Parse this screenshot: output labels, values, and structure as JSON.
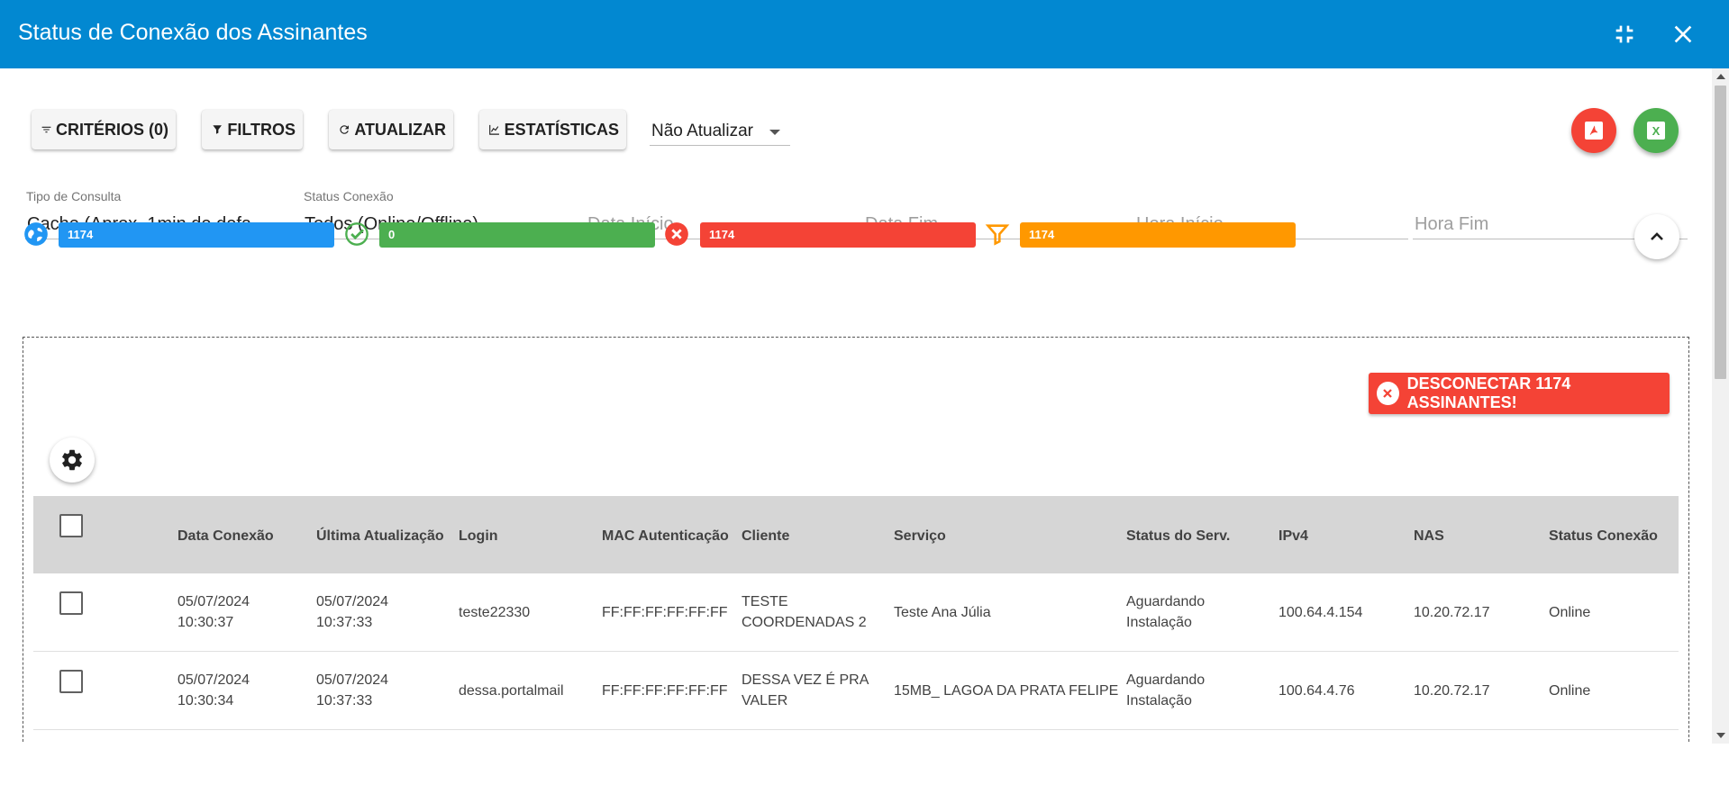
{
  "window": {
    "title": "Status de Conexão dos Assinantes",
    "icons": {
      "minimize": "fullscreen-exit-icon",
      "close": "close-icon"
    }
  },
  "toolbar": {
    "criterios_label": "CRITÉRIOS (0)",
    "filtros_label": "FILTROS",
    "atualizar_label": "ATUALIZAR",
    "estatisticas_label": "ESTATÍSTICAS",
    "refresh_select_value": "Não Atualizar",
    "pdf_label": "PDF",
    "excel_label": "X"
  },
  "filters": {
    "tipo_consulta": {
      "label": "Tipo de Consulta",
      "value": "Cache (Aprox. 1min de defa..."
    },
    "status_conexao": {
      "label": "Status Conexão",
      "value": "Todos (Online/Offline)"
    },
    "data_inicio": {
      "placeholder": "Data Início"
    },
    "data_fim": {
      "placeholder": "Data Fim"
    },
    "hora_inicio": {
      "placeholder": "Hora Início"
    },
    "hora_fim": {
      "placeholder": "Hora Fim"
    }
  },
  "stats": {
    "total": "1174",
    "online": "0",
    "offline": "1174",
    "filtered": "1174",
    "colors": {
      "total": "#2196f3",
      "online": "#4caf50",
      "offline": "#f44336",
      "filtered": "#ff9800"
    }
  },
  "actions": {
    "disconnect_label": "DESCONECTAR 1174 ASSINANTES!"
  },
  "table": {
    "columns": [
      "Data Conexão",
      "Última Atualização",
      "Login",
      "MAC Autenticação",
      "Cliente",
      "Serviço",
      "Status do Serv.",
      "IPv4",
      "NAS",
      "Status Conexão"
    ],
    "rows": [
      {
        "data_conexao": [
          "05/07/2024",
          "10:30:37"
        ],
        "ultima_atualizacao": [
          "05/07/2024",
          "10:37:33"
        ],
        "login": "teste22330",
        "mac": "FF:FF:FF:FF:FF:FF",
        "cliente": [
          "TESTE",
          "COORDENADAS 2"
        ],
        "servico": "Teste Ana Júlia",
        "status_serv": [
          "Aguardando",
          "Instalação"
        ],
        "ipv4": "100.64.4.154",
        "nas": "10.20.72.17",
        "status_conexao": "Online"
      },
      {
        "data_conexao": [
          "05/07/2024",
          "10:30:34"
        ],
        "ultima_atualizacao": [
          "05/07/2024",
          "10:37:33"
        ],
        "login": "dessa.portalmail",
        "mac": "FF:FF:FF:FF:FF:FF",
        "cliente": [
          "DESSA VEZ É PRA",
          "VALER"
        ],
        "servico": "15MB_ LAGOA DA PRATA FELIPE",
        "status_serv": [
          "Aguardando",
          "Instalação"
        ],
        "ipv4": "100.64.4.76",
        "nas": "10.20.72.17",
        "status_conexao": "Online"
      }
    ]
  }
}
